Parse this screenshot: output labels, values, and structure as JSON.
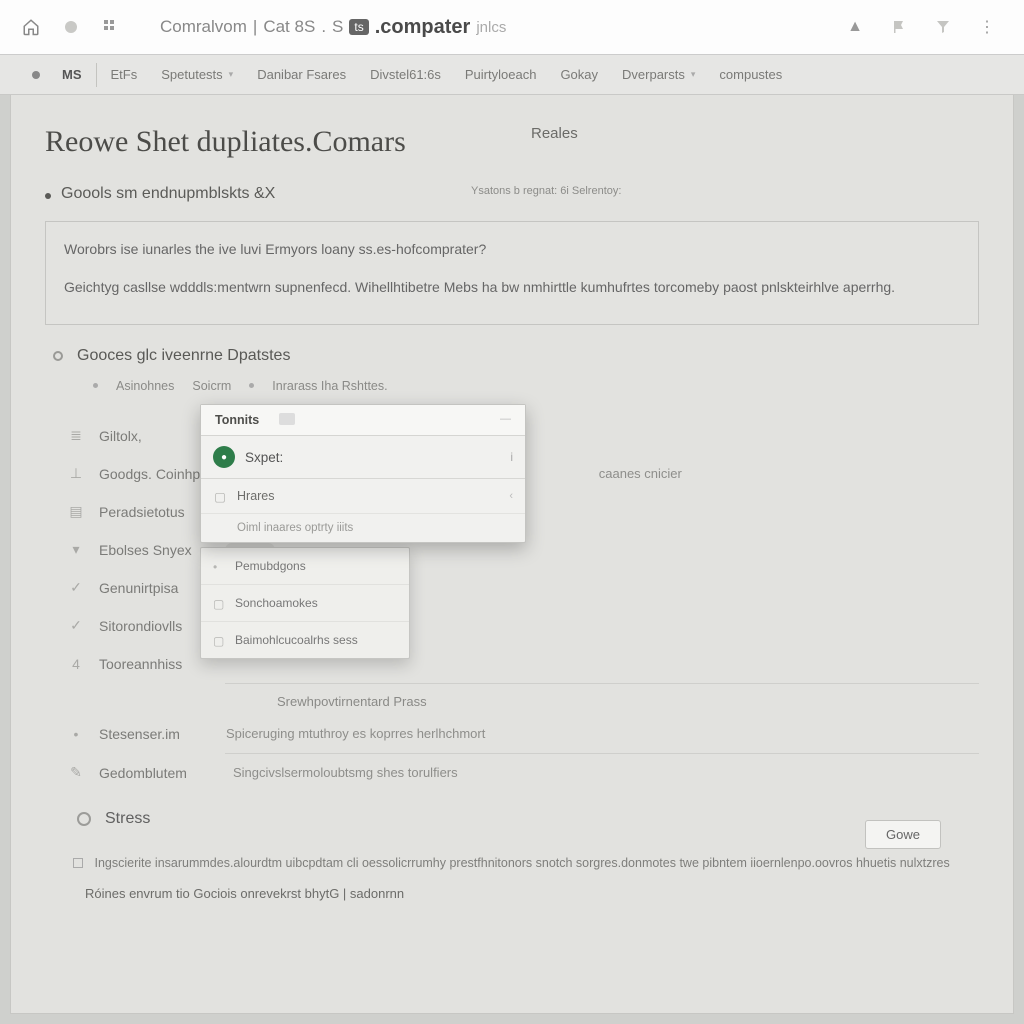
{
  "topbar": {
    "breadcrumb": {
      "a": "Comralvom",
      "b": "Cat 8S",
      "c": ".compater",
      "d": "jnlcs"
    },
    "chip": "ts"
  },
  "nav": {
    "tabs": [
      "MS",
      "EtFs",
      "Spetutests",
      "Danibar Fsares",
      "Divstel61:6s",
      "Puirtyloeach",
      "Gokay",
      "Dverparsts",
      "compustes"
    ]
  },
  "title": {
    "main": "Reowe Shet dupliates",
    "sub": ".Comars"
  },
  "hdr_tab": "Reales",
  "firstbullet": "Goools sm endnupmblskts &X",
  "helper": "Ysatons b regnat: 6i Selrentoy:",
  "infobox": {
    "l1": "Worobrs ise iunarles the ive luvi Ermyors loany ss.es-hofcomprater?",
    "l2": "Geichtyg casllse wdddls:mentwrn supnenfecd. Wihellhtibetre Mebs ha bw nmhirttle kumhufrtes torcomeby paost pnlskteirhlve aperrhg."
  },
  "subbullet": "Gooces glc iveenrne Dpatstes",
  "row_subs": {
    "a": "Asinohnes",
    "b": "Soicrm",
    "c": "Inrarass Iha Rshttes."
  },
  "sidelist": [
    {
      "icon": "book",
      "label": "Giltolx,"
    },
    {
      "icon": "plus",
      "label": "Goodgs. Coinhpafhl",
      "right": "caanes cnicier"
    },
    {
      "icon": "doc",
      "label": "Peradsietotus"
    },
    {
      "icon": "down",
      "label": "Ebolses Snyex"
    },
    {
      "icon": "check",
      "label": "Genunirtpisa"
    },
    {
      "icon": "check",
      "label": "Sitorondiovlls"
    },
    {
      "icon": "num",
      "label": "Tooreannhiss"
    },
    {
      "icon": "dot",
      "label": "Stesenser.im",
      "right": "Spiceruging mtuthroy es koprres herlhchmort"
    },
    {
      "icon": "pencil",
      "label": "Gedomblutem",
      "right": "Singcivslsermoloubtsmg shes torulfiers"
    }
  ],
  "popover": {
    "tab1": "Tonnits",
    "search": "Sxpet:",
    "opts": [
      "Hrares",
      "Pemubdgons",
      "Sonchoamokes",
      "Baimohlcucoalrhs sess"
    ],
    "sub": "Oiml inaares optrty iiits"
  },
  "popover2_note": "Srewhpovtirnentard Prass",
  "strss": "Stress",
  "footer_note": "Ingscierite insarummdes.alourdtm uibcpdtam cli oessolicrrumhy prestfhnitonors snotch sorgres.donmotes twe pibntem iioernlenpo.oovros hhuetis nulxtzres",
  "footer_cmd": "Róines envrum tio Gociois onrevekrst bhytG | sadonrnn",
  "gove": "Gowe"
}
